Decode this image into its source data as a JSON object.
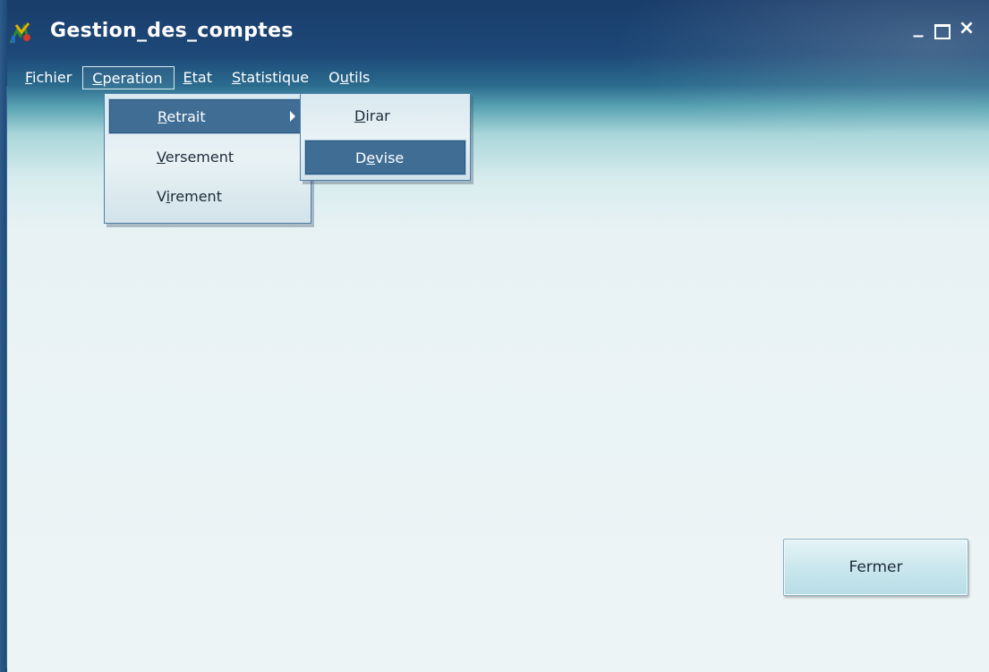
{
  "window": {
    "title": "Gestion_des_comptes",
    "app_icon": "app-logo-icon"
  },
  "titlebar_buttons": {
    "minimize": "_",
    "maximize": "□",
    "close": "×"
  },
  "menubar": [
    {
      "first": "F",
      "rest": "ichier"
    },
    {
      "first": "C",
      "rest": "peration",
      "active": true
    },
    {
      "first": "E",
      "rest": "tat"
    },
    {
      "first": "S",
      "rest": "tatistique"
    },
    {
      "pre": "O",
      "under": "u",
      "rest": "tils"
    }
  ],
  "operation_menu": [
    {
      "first": "R",
      "rest": "etrait",
      "highlighted": true,
      "has_submenu": true
    },
    {
      "first": "V",
      "rest": "ersement"
    },
    {
      "pre": "V",
      "under": "i",
      "rest": "rement"
    }
  ],
  "retrait_submenu": [
    {
      "first": "D",
      "rest": "irar"
    },
    {
      "pre": "D",
      "under": "e",
      "rest": "vise",
      "highlighted": true
    }
  ],
  "buttons": {
    "fermer": "Fermer"
  },
  "colors": {
    "titlebar": "#1d4877",
    "menu_highlight": "#3f6d94",
    "client": "#edf4f6"
  }
}
